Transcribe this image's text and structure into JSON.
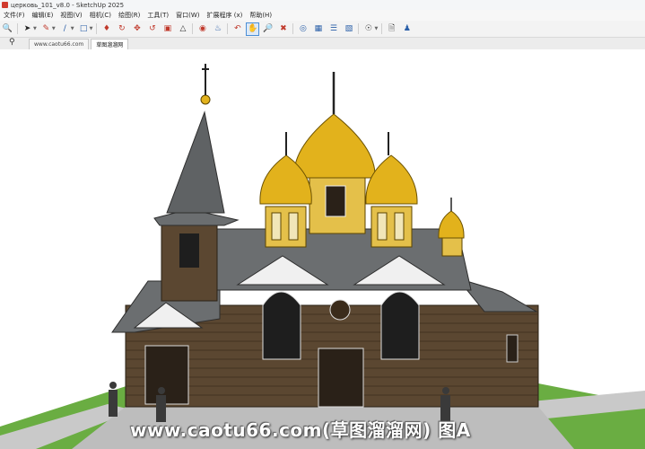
{
  "window": {
    "title": "церковь_101_v8.0 - SketchUp 2025"
  },
  "menu": {
    "items": [
      "文件(F)",
      "编辑(E)",
      "视图(V)",
      "相机(C)",
      "绘图(R)",
      "工具(T)",
      "窗口(W)",
      "扩展程序 (x)",
      "帮助(H)"
    ]
  },
  "toolbar": {
    "icons": [
      "zoom-search-icon",
      "select-arrow-icon",
      "eraser-pencil-icon",
      "line-draw-icon",
      "rectangle-icon",
      "push-pull-icon",
      "follow-me-icon",
      "move-icon",
      "rotate-icon",
      "scale-icon",
      "triangle-icon",
      "tape-measure-icon",
      "paint-bucket-icon",
      "orbit-icon",
      "pan-hand-icon",
      "zoom-icon",
      "zoom-extents-icon",
      "section-icon",
      "sandbox-icon",
      "layers-icon",
      "components-icon",
      "user-circle-icon",
      "new-file-icon",
      "account-icon"
    ]
  },
  "tabs": {
    "items": [
      "www.caotu66.com",
      "草图溜溜网"
    ],
    "selected": 1
  },
  "watermark": {
    "text": "www.caotu66.com(草图溜溜网) 图A"
  },
  "colors": {
    "gold": "#e2b21c",
    "roof": "#6b6e70",
    "wood": "#5a4630",
    "grass": "#5fa63a",
    "path": "#bfbfbf"
  }
}
